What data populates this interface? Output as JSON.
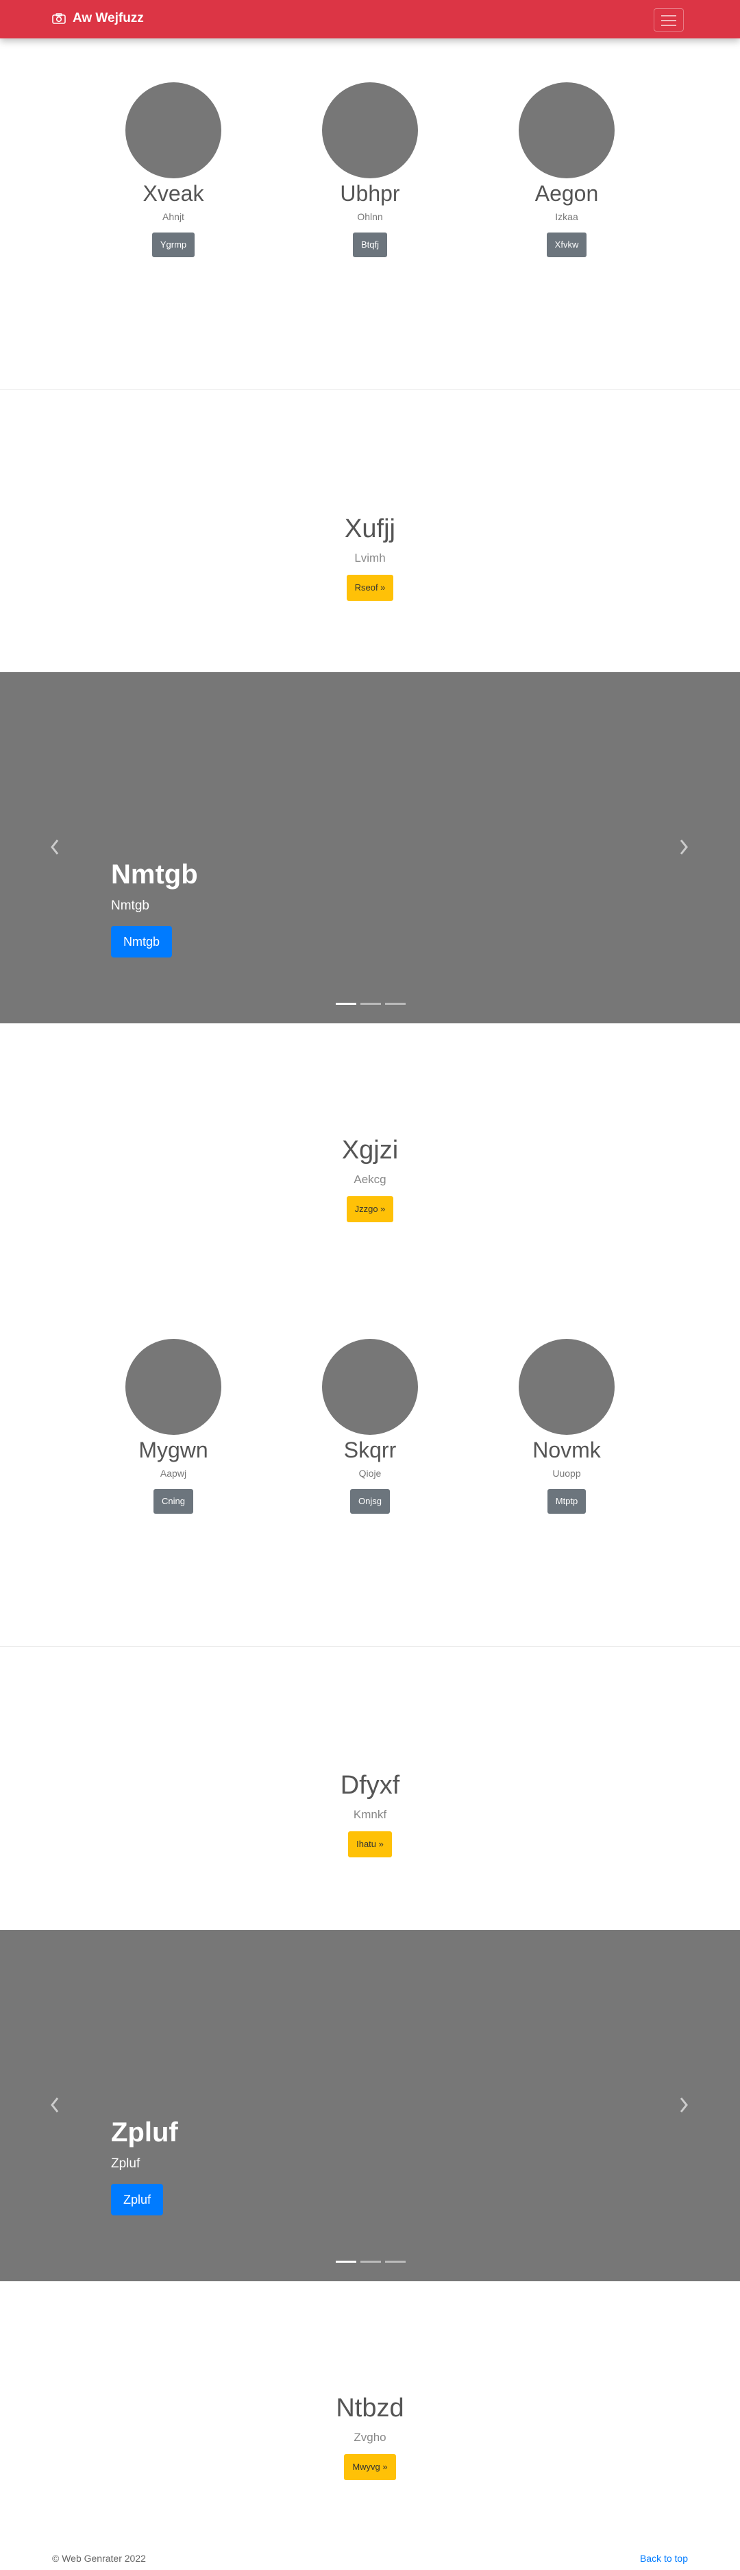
{
  "navbar": {
    "brand": "Aw Wejfuzz",
    "icon": "camera-icon",
    "menu_icon": "hamburger-menu-icon",
    "color": "#dc3545"
  },
  "team1": [
    {
      "name": "Xveak",
      "role": "Ahnjt",
      "button": "Ygrmp"
    },
    {
      "name": "Ubhpr",
      "role": "Ohlnn",
      "button": "Btqfj"
    },
    {
      "name": "Aegon",
      "role": "Izkaa",
      "button": "Xfvkw"
    }
  ],
  "feature1": {
    "title": "Xufjj",
    "subtitle": "Lvimh",
    "button": "Rseof »"
  },
  "carousel1": {
    "title": "Nmtgb",
    "text": "Nmtgb",
    "button": "Nmtgb"
  },
  "feature2": {
    "title": "Xgjzi",
    "subtitle": "Aekcg",
    "button": "Jzzgo »"
  },
  "team2": [
    {
      "name": "Mygwn",
      "role": "Aapwj",
      "button": "Cning"
    },
    {
      "name": "Skqrr",
      "role": "Qioje",
      "button": "Onjsg"
    },
    {
      "name": "Novmk",
      "role": "Uuopp",
      "button": "Mtptp"
    }
  ],
  "feature3": {
    "title": "Dfyxf",
    "subtitle": "Kmnkf",
    "button": "Ihatu »"
  },
  "carousel2": {
    "title": "Zpluf",
    "text": "Zpluf",
    "button": "Zpluf"
  },
  "feature4": {
    "title": "Ntbzd",
    "subtitle": "Zvgho",
    "button": "Mwyvg »"
  },
  "footer": {
    "copyright": "© Web Genrater 2022",
    "back_to_top": "Back to top"
  },
  "colors": {
    "primary": "#007bff",
    "warning": "#ffc107",
    "secondary": "#6c757d",
    "placeholder": "#777777"
  }
}
